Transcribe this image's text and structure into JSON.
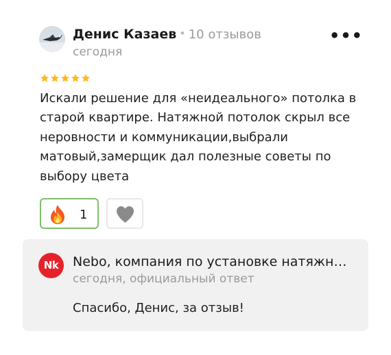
{
  "review": {
    "author": "Денис Казаев",
    "separator": "•",
    "review_count": "10 отзывов",
    "date": "сегодня",
    "more_label": "•••",
    "rating": 5,
    "rating_max": 5,
    "star_color": "#ffb81c",
    "text": "Искали решение для «неидеального» потолка в старой квартире. Натяжной потолок скрыл все неровности и коммуникации,выбрали матовый,замерщик дал полезные советы по выбору цвета",
    "reactions": {
      "fire_icon": "fire-emoji-icon",
      "fire_count": "1",
      "like_icon": "heart-icon",
      "accent_border": "#7fbf6a"
    }
  },
  "reply": {
    "logo_text": "Nk",
    "logo_color": "#e5222a",
    "company": "Nebo, компания по установке натяжн…",
    "meta": "сегодня, официальный ответ",
    "text": "Спасибо, Денис, за отзыв!"
  }
}
